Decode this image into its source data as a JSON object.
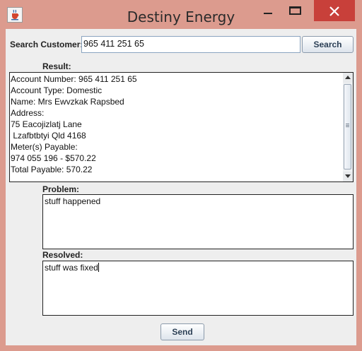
{
  "window": {
    "title": "Destiny Energy",
    "icon": "java-cup-icon",
    "close_color": "#c8403a"
  },
  "search": {
    "label": "Search Customer:",
    "value": "965 411 251 65",
    "button_label": "Search"
  },
  "result": {
    "label": "Result:",
    "text": "Account Number: 965 411 251 65\nAccount Type: Domestic\nName: Mrs Ewvzkak Rapsbed\nAddress:\n75 Eacojizlatj Lane\n Lzafbtbtyi Qld 4168\nMeter(s) Payable:\n974 055 196 - $570.22\nTotal Payable: 570.22"
  },
  "problem": {
    "label": "Problem:",
    "value": "stuff happened"
  },
  "resolved": {
    "label": "Resolved:",
    "value": "stuff was fixed"
  },
  "send": {
    "label": "Send"
  }
}
